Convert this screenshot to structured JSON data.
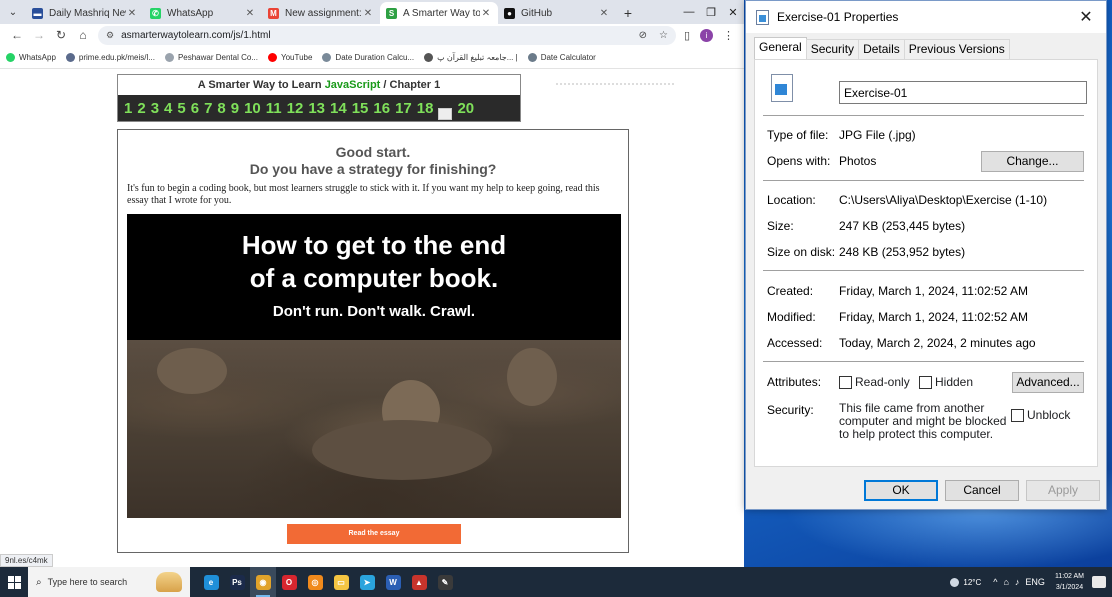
{
  "browser": {
    "tabs": [
      {
        "title": "Daily Mashriq Newspape",
        "fav_color": "#2a4f9a",
        "fav_glyph": "▬",
        "active": false
      },
      {
        "title": "WhatsApp",
        "fav_color": "#25d366",
        "fav_glyph": "✆",
        "active": false
      },
      {
        "title": "New assignment: \"JavaSc",
        "fav_color": "#ea4335",
        "fav_glyph": "M",
        "active": false
      },
      {
        "title": "A Smarter Way to Learn",
        "fav_color": "#2ea043",
        "fav_glyph": "S",
        "active": true
      },
      {
        "title": "GitHub",
        "fav_color": "#111111",
        "fav_glyph": "●",
        "active": false
      }
    ],
    "url": "asmarterwaytolearn.com/js/1.html",
    "profile_initial": "i",
    "bookmarks": [
      {
        "label": "WhatsApp",
        "color": "#25d366"
      },
      {
        "label": "prime.edu.pk/meis/l...",
        "color": "#5b6b8c"
      },
      {
        "label": "Peshawar Dental Co...",
        "color": "#9aa3ad"
      },
      {
        "label": "YouTube",
        "color": "#ff0000"
      },
      {
        "label": "Date Duration Calcu...",
        "color": "#7a8a99"
      },
      {
        "label": "جامعہ تبلیغ القرآن پ... |",
        "color": "#555555"
      },
      {
        "label": "Date Calculator",
        "color": "#6b7b8a"
      }
    ],
    "status_url": "9nl.es/c4mk"
  },
  "page": {
    "chapter_header_prefix": "A Smarter Way to Learn",
    "chapter_header_js": "JavaScript",
    "chapter_header_suffix": "/  Chapter 1",
    "chapters_a": [
      "1",
      "2",
      "3",
      "4",
      "5",
      "6",
      "7",
      "8",
      "9",
      "10",
      "11",
      "12",
      "13",
      "14",
      "15",
      "16",
      "17",
      "18"
    ],
    "chapter_last": "20",
    "modal": {
      "heading1": "Good start.",
      "heading2": "Do you have a strategy for finishing?",
      "paragraph": "It's fun to begin a coding book, but most learners struggle to stick with it. If you want my help to keep going, read this essay that I wrote for you.",
      "poster_line1": "How to get to the end",
      "poster_line2": "of a computer book.",
      "poster_line3": "Don't run. Don't walk. Crawl.",
      "button": "Read the essay"
    }
  },
  "dialog": {
    "title": "Exercise-01 Properties",
    "tabs": [
      "General",
      "Security",
      "Details",
      "Previous Versions"
    ],
    "file_name": "Exercise-01",
    "type_label": "Type of file:",
    "type_value": "JPG File (.jpg)",
    "opens_label": "Opens with:",
    "opens_value": "Photos",
    "change_button": "Change...",
    "location_label": "Location:",
    "location_value": "C:\\Users\\Aliya\\Desktop\\Exercise (1-10)",
    "size_label": "Size:",
    "size_value": "247 KB (253,445 bytes)",
    "sizeondisk_label": "Size on disk:",
    "sizeondisk_value": "248 KB (253,952 bytes)",
    "created_label": "Created:",
    "created_value": "Friday, March 1, 2024, 11:02:52 AM",
    "modified_label": "Modified:",
    "modified_value": "Friday, March 1, 2024, 11:02:52 AM",
    "accessed_label": "Accessed:",
    "accessed_value": "Today, March 2, 2024, 2 minutes ago",
    "attributes_label": "Attributes:",
    "readonly_label": "Read-only",
    "hidden_label": "Hidden",
    "advanced_button": "Advanced...",
    "security_label": "Security:",
    "security_note": "This file came from another computer and might be blocked to help protect this computer.",
    "unblock_label": "Unblock",
    "ok": "OK",
    "cancel": "Cancel",
    "apply": "Apply"
  },
  "taskbar": {
    "search_placeholder": "Type here to search",
    "apps": [
      {
        "name": "edge",
        "color": "#1f8fd8",
        "glyph": "e"
      },
      {
        "name": "photoshop",
        "color": "#1b2a4a",
        "glyph": "Ps"
      },
      {
        "name": "chrome",
        "color": "#e1a32a",
        "glyph": "◉"
      },
      {
        "name": "opera",
        "color": "#d7262f",
        "glyph": "O"
      },
      {
        "name": "app-orange",
        "color": "#f08a1c",
        "glyph": "◎"
      },
      {
        "name": "file-explorer",
        "color": "#f4c542",
        "glyph": "▭"
      },
      {
        "name": "telegram",
        "color": "#2aa4dd",
        "glyph": "➤"
      },
      {
        "name": "word",
        "color": "#2b5fb4",
        "glyph": "W"
      },
      {
        "name": "app-red",
        "color": "#c8342c",
        "glyph": "▲"
      },
      {
        "name": "app-pen",
        "color": "#3a3a3a",
        "glyph": "✎"
      }
    ],
    "temperature": "12°C",
    "language": "ENG",
    "time": "11:02 AM",
    "date": "3/1/2024"
  }
}
